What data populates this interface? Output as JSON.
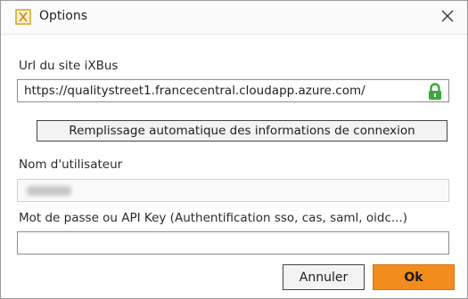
{
  "window": {
    "title": "Options",
    "app_icon": "ixbus-logo-icon",
    "close_icon": "close-icon"
  },
  "form": {
    "url_label": "Url du site iXBus",
    "url_value": "https://qualitystreet1.francecentral.cloudapp.azure.com/",
    "lock_icon": "lock-icon",
    "lock_color": "#3aa83a",
    "autofill_label": "Remplissage automatique des informations de connexion",
    "username_label": "Nom d'utilisateur",
    "password_label": "Mot de passe ou API Key (Authentification sso, cas, saml, oidc...)",
    "password_value": ""
  },
  "footer": {
    "cancel_label": "Annuler",
    "ok_label": "Ok",
    "ok_color": "#f28c1c"
  }
}
